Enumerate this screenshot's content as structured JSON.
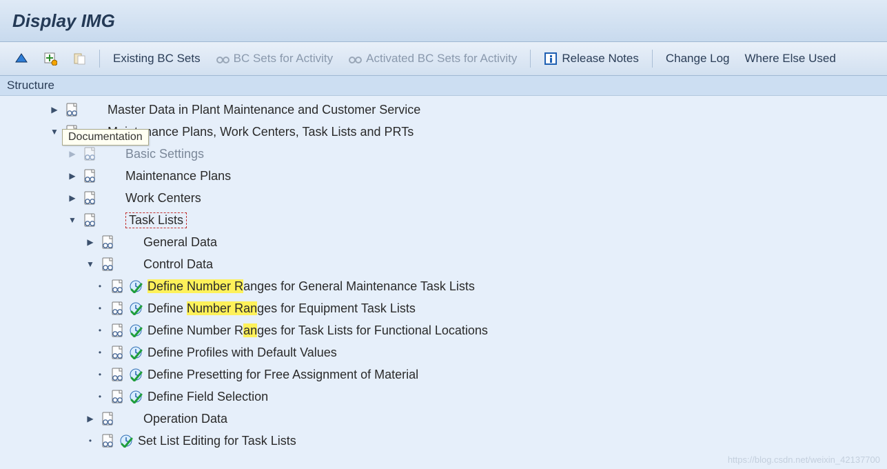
{
  "title": "Display IMG",
  "toolbar": {
    "existing_bc_sets": "Existing BC Sets",
    "bc_sets_for_activity": "BC Sets for Activity",
    "activated_bc_sets_for_activity": "Activated BC Sets for Activity",
    "release_notes": "Release Notes",
    "change_log": "Change Log",
    "where_else_used": "Where Else Used"
  },
  "structure_label": "Structure",
  "tooltip_text": "Documentation",
  "watermark": "https://blog.csdn.net/weixin_42137700",
  "tree": {
    "n0": "Master Data in Plant Maintenance and Customer Service",
    "n1": "Maintenance Plans, Work Centers, Task Lists and PRTs",
    "n2": "Basic Settings",
    "n3": "Maintenance Plans",
    "n4": "Work Centers",
    "n5": "Task Lists",
    "n6": "General Data",
    "n7": "Control Data",
    "n8_a": "Define Number R",
    "n8_b": "anges for General Maintenance Task Lists",
    "n9_a": "Define ",
    "n9_b": "Number Ran",
    "n9_c": "ges for Equipment Task Lists",
    "n10_a": "Define Number R",
    "n10_b": "an",
    "n10_c": "ges for Task Lists for Functional Locations",
    "n11": "Define Profiles with Default Values",
    "n12": "Define Presetting for Free Assignment of Material",
    "n13": "Define Field Selection",
    "n14": "Operation Data",
    "n15": "Set List Editing for Task Lists"
  }
}
